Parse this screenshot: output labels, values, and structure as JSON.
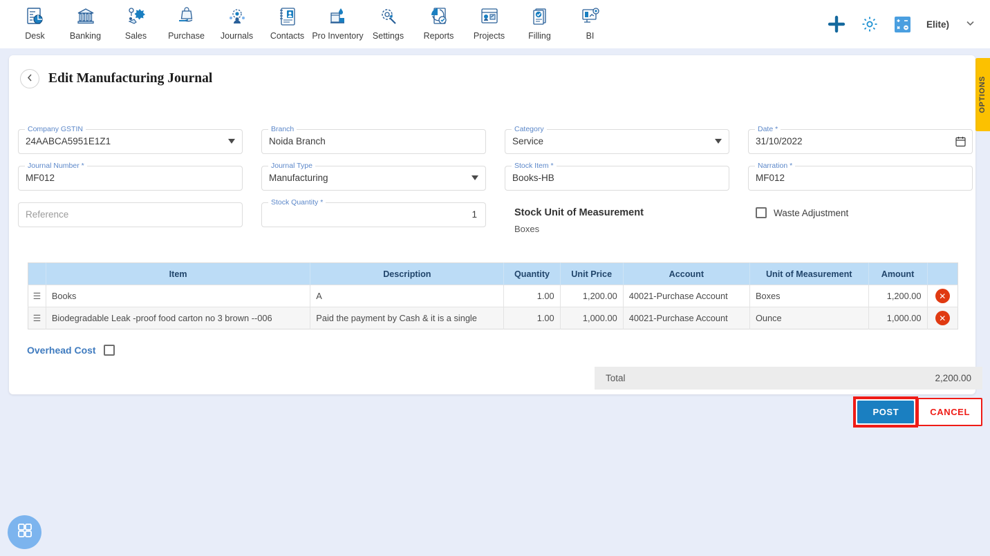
{
  "nav": {
    "items": [
      {
        "label": "Desk",
        "icon": "desk-dashboard-icon"
      },
      {
        "label": "Banking",
        "icon": "bank-building-icon"
      },
      {
        "label": "Sales",
        "icon": "sales-megaphone-icon"
      },
      {
        "label": "Purchase",
        "icon": "purchase-bag-hand-icon"
      },
      {
        "label": "Journals",
        "icon": "journals-gear-people-icon"
      },
      {
        "label": "Contacts",
        "icon": "contacts-card-icon"
      },
      {
        "label": "Pro Inventory",
        "icon": "inventory-box-icon"
      },
      {
        "label": "Settings",
        "icon": "settings-gear-wrench-icon"
      },
      {
        "label": "Reports",
        "icon": "reports-pie-chart-icon"
      },
      {
        "label": "Projects",
        "icon": "projects-board-icon"
      },
      {
        "label": "Filling",
        "icon": "filling-documents-icon"
      },
      {
        "label": "BI",
        "icon": "bi-monitor-icon"
      }
    ],
    "right": {
      "add_icon": "plus-icon",
      "settings_icon": "gear-icon",
      "calculator_icon": "calculator-icon",
      "user_name": "Elite)",
      "caret_icon": "chevron-down-icon"
    }
  },
  "options_tab": {
    "label": "OPTIONS",
    "color": "#fcc100"
  },
  "header": {
    "back_icon": "chevron-left-icon",
    "title": "Edit Manufacturing Journal"
  },
  "form": {
    "company_gstin": {
      "label": "Company GSTIN",
      "value": "24AABCA5951E1Z1"
    },
    "branch": {
      "label": "Branch",
      "value": "Noida Branch"
    },
    "category": {
      "label": "Category",
      "value": "Service"
    },
    "date": {
      "label": "Date *",
      "value": "31/10/2022"
    },
    "journal_number": {
      "label": "Journal Number *",
      "value": "MF012"
    },
    "journal_type": {
      "label": "Journal Type",
      "value": "Manufacturing"
    },
    "stock_item": {
      "label": "Stock Item *",
      "value": "Books-HB"
    },
    "narration": {
      "label": "Narration *",
      "value": "MF012"
    },
    "reference": {
      "placeholder": "Reference",
      "value": ""
    },
    "stock_quantity": {
      "label": "Stock Quantity *",
      "value": "1"
    },
    "stock_uom": {
      "title": "Stock Unit of Measurement",
      "value": "Boxes"
    },
    "waste_adjustment": {
      "label": "Waste Adjustment",
      "checked": false
    }
  },
  "table": {
    "columns": [
      "",
      "Item",
      "Description",
      "Quantity",
      "Unit Price",
      "Account",
      "Unit of Measurement",
      "Amount",
      ""
    ],
    "header_bg": "#bcdcf6",
    "rows": [
      {
        "handle": "drag-handle-icon",
        "item": "Books",
        "description": "A",
        "quantity": "1.00",
        "unit_price": "1,200.00",
        "account": "40021-Purchase Account",
        "uom": "Boxes",
        "amount": "1,200.00",
        "delete_icon": "delete-circle-icon"
      },
      {
        "handle": "drag-handle-icon",
        "item": "Biodegradable Leak -proof food carton no 3 brown --006",
        "description": "Paid the payment by Cash & it is a single",
        "quantity": "1.00",
        "unit_price": "1,000.00",
        "account": "40021-Purchase Account",
        "uom": "Ounce",
        "amount": "1,000.00",
        "delete_icon": "delete-circle-icon"
      }
    ]
  },
  "overhead": {
    "label": "Overhead Cost",
    "checked": false
  },
  "totals": {
    "label": "Total",
    "value": "2,200.00"
  },
  "actions": {
    "post_label": "POST",
    "cancel_label": "CANCEL",
    "post_color": "#1a7fc1",
    "highlight_color": "#ef1b16"
  },
  "fab": {
    "icon": "apps-grid-icon",
    "color": "#7cb4ee"
  }
}
